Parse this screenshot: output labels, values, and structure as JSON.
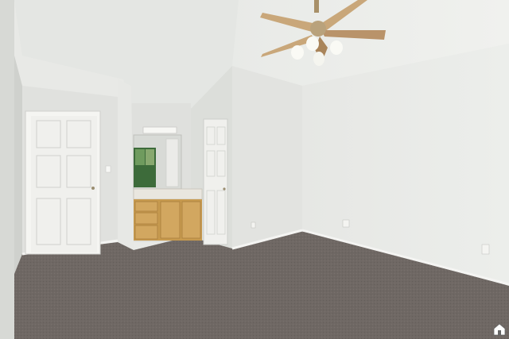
{
  "scene": {
    "description_free": true,
    "colors": {
      "ceiling": "#eceeeb",
      "wall_right": "#e9eae7",
      "wall_center": "#e3e4e1",
      "wall_left": "#d9dbd7",
      "carpet": "#6f6864",
      "door": "#f1f1ee",
      "cabinet": "#c89b52",
      "fan_blade": "#c9a77a",
      "trim": "#f4f4f2"
    },
    "icons": [
      "ceiling-fan-icon",
      "watermark-house-icon"
    ]
  }
}
